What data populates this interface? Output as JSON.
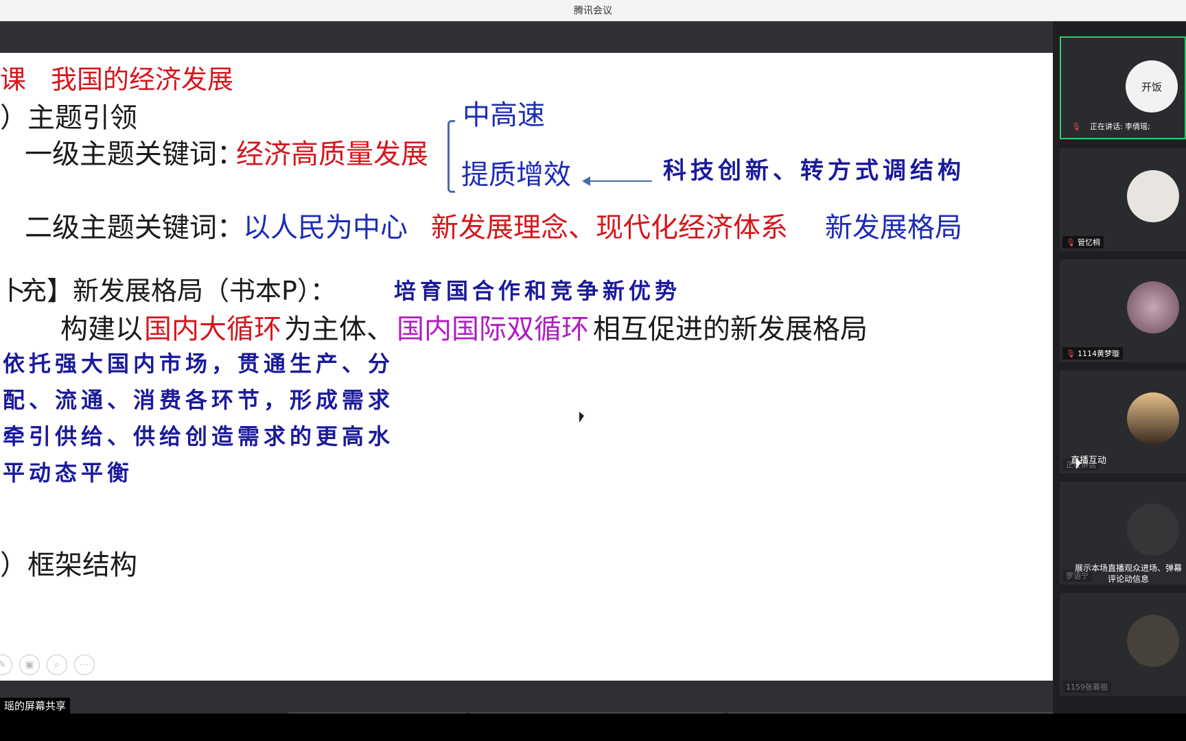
{
  "window": {
    "title": "腾讯会议"
  },
  "share": {
    "label": "瑶的屏幕共享"
  },
  "slide": {
    "title_prefix": "课",
    "title": "我国的经济发展",
    "section1": "）主题引领",
    "level1_label": "一级主题关键词：",
    "level1_value": "经济高质量发展",
    "branch_top": "中高速",
    "branch_bottom": "提质增效",
    "arrow_note": "科技创新、转方式调结构",
    "level2_label": "二级主题关键词：",
    "level2_a": "以人民为中心",
    "level2_b": "新发展理念、现代化经济体系",
    "level2_c": "新发展格局",
    "supp_label": "充】新发展格局（书本P）：",
    "supp_note": "培育国合作和竞争新优势",
    "build_a": "构建以",
    "build_b": "国内大循环",
    "build_c": "为主体、",
    "build_d": "国内国际双循环",
    "build_e": "相互促进的新发展格局",
    "hand_lines": [
      "依托强大国内市场，贯通生产、分",
      "配、流通、消费各环节，形成需求",
      "牵引供给、供给创造需求的更高水",
      "平动态平衡"
    ],
    "section2": "）框架结构",
    "prefix_supp": "卜"
  },
  "participants": [
    {
      "name": "正在讲话: 李倩瑶;",
      "avatar_text": "开饭",
      "avatar_color": "#f2f2f2"
    },
    {
      "name": "管忆桐",
      "avatar_color": "#e8e4df"
    },
    {
      "name": "1114黄梦璇",
      "avatar_color": "#6b4a5e"
    },
    {
      "name": "正在讲话",
      "avatar_color": "#d9a86b"
    },
    {
      "name": "罗语宁",
      "avatar_color": "#3a3a3a"
    },
    {
      "name": "1159张慕祖",
      "avatar_color": "#5a5040"
    }
  ],
  "tooltip": {
    "title": "直播互动",
    "desc": "展示本场直播观众进场、弹幕评论动信息"
  },
  "colors": {
    "accent_green": "#2ecc71",
    "bar": "#2f3033"
  }
}
